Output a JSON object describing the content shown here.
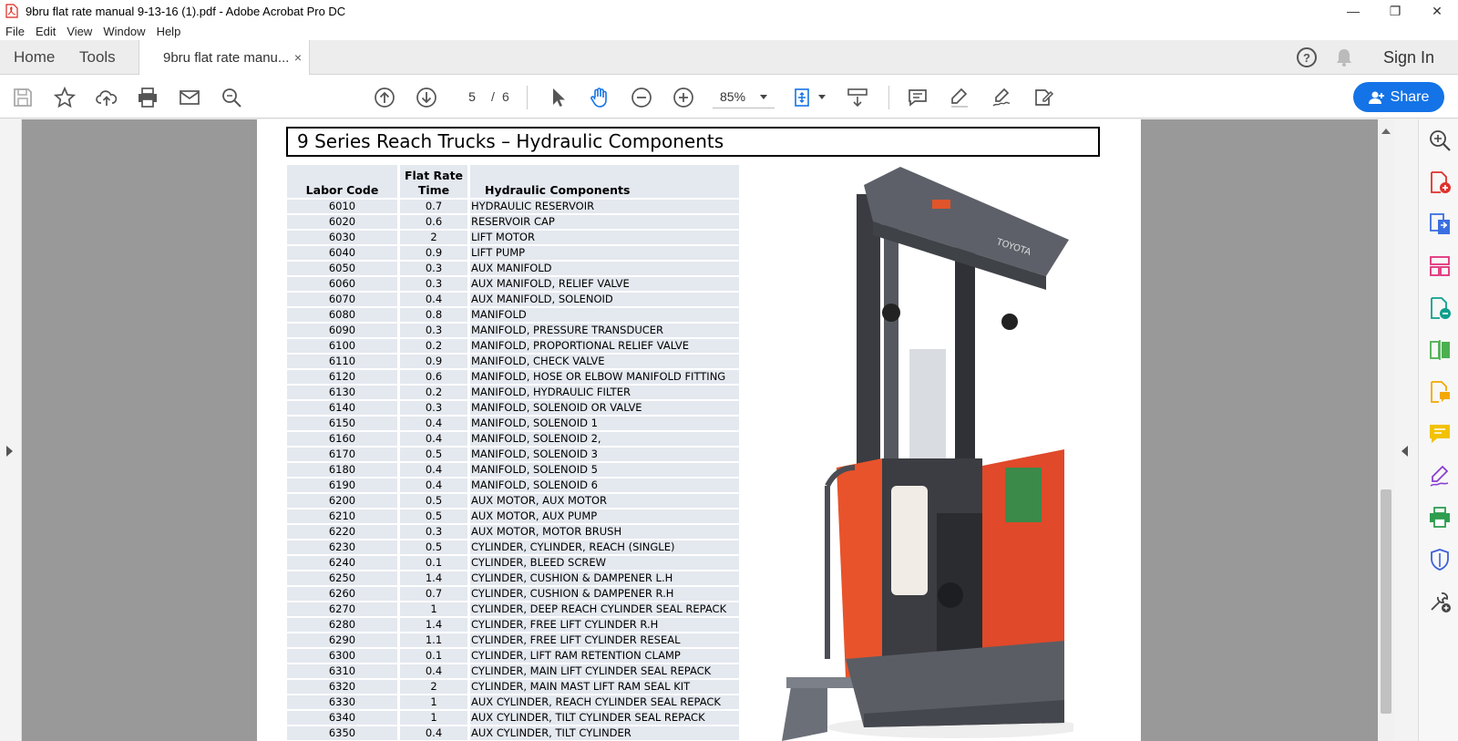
{
  "window": {
    "title": "9bru flat rate manual 9-13-16 (1).pdf - Adobe Acrobat Pro DC",
    "minimize": "—",
    "restore": "❐",
    "close": "✕"
  },
  "menu": [
    "File",
    "Edit",
    "View",
    "Window",
    "Help"
  ],
  "tabs": {
    "home": "Home",
    "tools": "Tools",
    "doc_tab": "9bru flat rate manu...",
    "doc_tab_close": "×",
    "sign_in": "Sign In",
    "help": "?"
  },
  "toolbar": {
    "current_page": "5",
    "page_sep": "/",
    "total_pages": "6",
    "zoom": "85%",
    "share": "Share",
    "accent_color": "#1473e6"
  },
  "document": {
    "title": "9 Series Reach Trucks – Hydraulic Components",
    "columns": {
      "code": "Labor Code",
      "rate_line1": "Flat Rate",
      "rate_line2": "Time",
      "desc": "Hydraulic Components"
    },
    "rows": [
      {
        "code": "6010",
        "rate": "0.7",
        "desc": "HYDRAULIC RESERVOIR"
      },
      {
        "code": "6020",
        "rate": "0.6",
        "desc": "RESERVOIR CAP"
      },
      {
        "code": "6030",
        "rate": "2",
        "desc": "LIFT MOTOR"
      },
      {
        "code": "6040",
        "rate": "0.9",
        "desc": "LIFT PUMP"
      },
      {
        "code": "6050",
        "rate": "0.3",
        "desc": "AUX MANIFOLD"
      },
      {
        "code": "6060",
        "rate": "0.3",
        "desc": "AUX MANIFOLD, RELIEF VALVE"
      },
      {
        "code": "6070",
        "rate": "0.4",
        "desc": "AUX MANIFOLD, SOLENOID"
      },
      {
        "code": "6080",
        "rate": "0.8",
        "desc": "MANIFOLD"
      },
      {
        "code": "6090",
        "rate": "0.3",
        "desc": "MANIFOLD, PRESSURE TRANSDUCER"
      },
      {
        "code": "6100",
        "rate": "0.2",
        "desc": "MANIFOLD, PROPORTIONAL RELIEF VALVE"
      },
      {
        "code": "6110",
        "rate": "0.9",
        "desc": "MANIFOLD, CHECK VALVE"
      },
      {
        "code": "6120",
        "rate": "0.6",
        "desc": "MANIFOLD, HOSE OR ELBOW MANIFOLD FITTING"
      },
      {
        "code": "6130",
        "rate": "0.2",
        "desc": "MANIFOLD, HYDRAULIC FILTER"
      },
      {
        "code": "6140",
        "rate": "0.3",
        "desc": "MANIFOLD, SOLENOID OR VALVE"
      },
      {
        "code": "6150",
        "rate": "0.4",
        "desc": "MANIFOLD, SOLENOID 1"
      },
      {
        "code": "6160",
        "rate": "0.4",
        "desc": "MANIFOLD, SOLENOID 2,"
      },
      {
        "code": "6170",
        "rate": "0.5",
        "desc": "MANIFOLD, SOLENOID 3"
      },
      {
        "code": "6180",
        "rate": "0.4",
        "desc": "MANIFOLD, SOLENOID 5"
      },
      {
        "code": "6190",
        "rate": "0.4",
        "desc": "MANIFOLD, SOLENOID 6"
      },
      {
        "code": "6200",
        "rate": "0.5",
        "desc": "AUX MOTOR, AUX MOTOR"
      },
      {
        "code": "6210",
        "rate": "0.5",
        "desc": "AUX MOTOR, AUX PUMP"
      },
      {
        "code": "6220",
        "rate": "0.3",
        "desc": "AUX MOTOR, MOTOR BRUSH"
      },
      {
        "code": "6230",
        "rate": "0.5",
        "desc": "CYLINDER, CYLINDER, REACH (SINGLE)"
      },
      {
        "code": "6240",
        "rate": "0.1",
        "desc": "CYLINDER, BLEED SCREW"
      },
      {
        "code": "6250",
        "rate": "1.4",
        "desc": "CYLINDER, CUSHION & DAMPENER L.H"
      },
      {
        "code": "6260",
        "rate": "0.7",
        "desc": "CYLINDER, CUSHION & DAMPENER R.H"
      },
      {
        "code": "6270",
        "rate": "1",
        "desc": "CYLINDER, DEEP REACH CYLINDER SEAL REPACK"
      },
      {
        "code": "6280",
        "rate": "1.4",
        "desc": "CYLINDER, FREE LIFT CYLINDER R.H"
      },
      {
        "code": "6290",
        "rate": "1.1",
        "desc": "CYLINDER, FREE LIFT CYLINDER RESEAL"
      },
      {
        "code": "6300",
        "rate": "0.1",
        "desc": "CYLINDER, LIFT RAM RETENTION CLAMP"
      },
      {
        "code": "6310",
        "rate": "0.4",
        "desc": "CYLINDER, MAIN LIFT CYLINDER SEAL REPACK"
      },
      {
        "code": "6320",
        "rate": "2",
        "desc": "CYLINDER, MAIN MAST LIFT RAM SEAL KIT"
      },
      {
        "code": "6330",
        "rate": "1",
        "desc": "AUX CYLINDER, REACH CYLINDER SEAL REPACK"
      },
      {
        "code": "6340",
        "rate": "1",
        "desc": "AUX CYLINDER, TILT CYLINDER SEAL REPACK"
      },
      {
        "code": "6350",
        "rate": "0.4",
        "desc": "AUX CYLINDER, TILT CYLINDER"
      }
    ],
    "image_brand": "TOYOTA"
  }
}
